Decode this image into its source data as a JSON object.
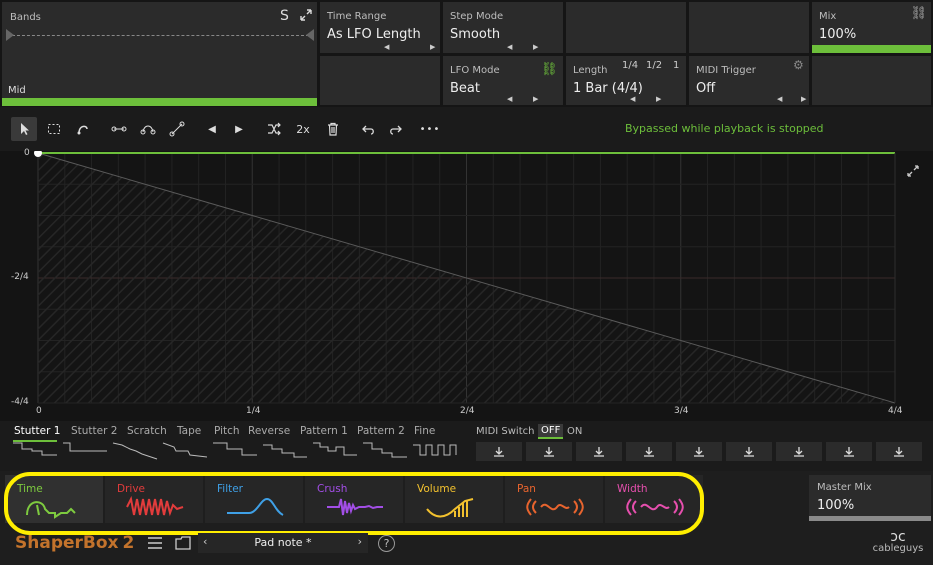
{
  "bands": {
    "label": "Bands",
    "s_label": "S",
    "selected_band": "Mid"
  },
  "time_range": {
    "label": "Time Range",
    "value": "As LFO Length"
  },
  "step_mode": {
    "label": "Step Mode",
    "value": "Smooth"
  },
  "lfo_mode": {
    "label": "LFO Mode",
    "value": "Beat"
  },
  "length": {
    "label": "Length",
    "options": [
      "1/4",
      "1/2",
      "1"
    ],
    "value": "1 Bar (4/4)"
  },
  "midi_trigger": {
    "label": "MIDI Trigger",
    "value": "Off"
  },
  "mix": {
    "label": "Mix",
    "value": "100%",
    "level": 1.0
  },
  "toolbar": {
    "zoom_label": "2x",
    "status": "Bypassed while playback is stopped",
    "more": "•••"
  },
  "graph": {
    "y_labels": [
      "0",
      "-2/4",
      "-4/4"
    ],
    "x_labels": [
      "0",
      "1/4",
      "2/4",
      "3/4",
      "4/4"
    ],
    "shape": {
      "start": [
        0,
        0
      ],
      "end": [
        1,
        -1
      ],
      "type": "line"
    }
  },
  "presets": {
    "items": [
      "Stutter 1",
      "Stutter 2",
      "Scratch",
      "Tape",
      "Pitch",
      "Reverse",
      "Pattern 1",
      "Pattern 2",
      "Fine"
    ],
    "active": "Stutter 1",
    "midi_switch": "MIDI Switch",
    "off": "OFF",
    "on": "ON",
    "download_slots": 9
  },
  "modules": [
    {
      "name": "Time",
      "color": "#7ecb3f",
      "icon": "time-wave-icon"
    },
    {
      "name": "Drive",
      "color": "#e23c3c",
      "icon": "drive-wave-icon"
    },
    {
      "name": "Filter",
      "color": "#3fa0e6",
      "icon": "filter-wave-icon"
    },
    {
      "name": "Crush",
      "color": "#a24ee6",
      "icon": "crush-wave-icon"
    },
    {
      "name": "Volume",
      "color": "#f2c12e",
      "icon": "volume-wave-icon"
    },
    {
      "name": "Pan",
      "color": "#e8642e",
      "icon": "pan-wave-icon"
    },
    {
      "name": "Width",
      "color": "#e64fae",
      "icon": "width-wave-icon"
    }
  ],
  "master_mix": {
    "label": "Master Mix",
    "value": "100%"
  },
  "footer": {
    "logo_main": "ShaperBox",
    "logo_num": "2",
    "patch_name": "Pad note *",
    "help": "?",
    "brand": "cableguys",
    "brand_mark": "ↄc"
  }
}
